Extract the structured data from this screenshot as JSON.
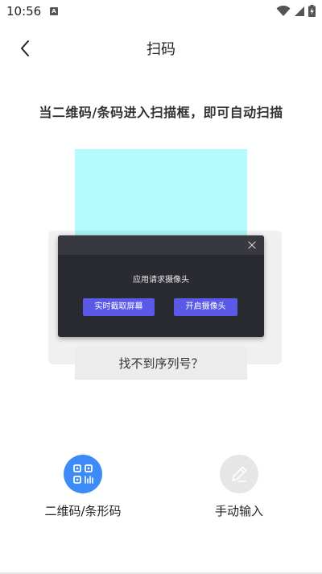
{
  "status_bar": {
    "time": "10:56",
    "notification_glyph": "A",
    "icons": [
      "wifi-icon",
      "signal-icon",
      "battery-charging-icon"
    ]
  },
  "header": {
    "title": "扫码",
    "back_icon": "chevron-left-icon"
  },
  "instruction": "当二维码/条码进入扫描框，即可自动扫描",
  "scan": {
    "frame_color": "#b3fbfc",
    "serial_link": "找不到序列号？"
  },
  "dialog": {
    "message": "应用请求摄像头",
    "buttons": [
      {
        "label": "实时截取屏幕"
      },
      {
        "label": "开启摄像头"
      }
    ],
    "accent": "#5b59e8",
    "close_icon": "close-icon"
  },
  "modes": [
    {
      "label": "二维码/条形码",
      "icon": "qr-code-icon",
      "color": "#3d8bf7",
      "active": true
    },
    {
      "label": "手动输入",
      "icon": "pencil-icon",
      "color": "#e6e6e6",
      "active": false
    }
  ]
}
